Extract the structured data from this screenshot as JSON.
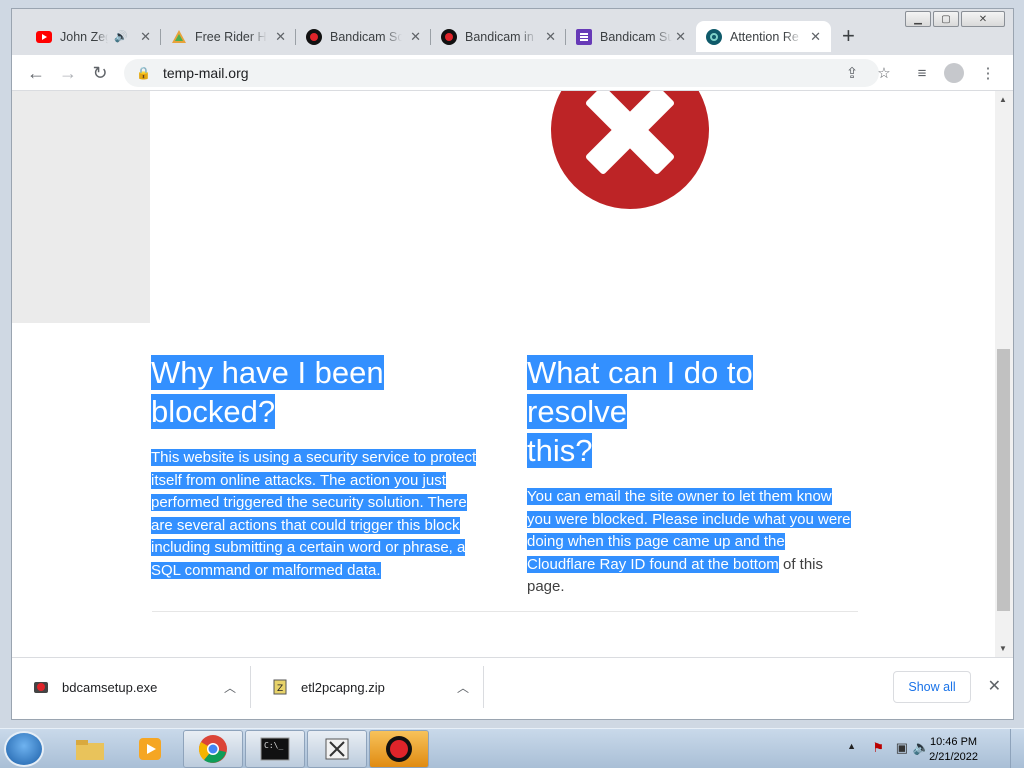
{
  "browser": {
    "tabs": [
      {
        "title": "John Zeg",
        "favicon": "youtube-icon",
        "audio": true
      },
      {
        "title": "Free Rider HD",
        "favicon": "chrome-web-icon"
      },
      {
        "title": "Bandicam Sc",
        "favicon": "bandicam-icon"
      },
      {
        "title": "Bandicam in",
        "favicon": "bandicam-icon"
      },
      {
        "title": "Bandicam Su",
        "favicon": "forms-icon"
      },
      {
        "title": "Attention Re",
        "favicon": "cloudflare-icon",
        "active": true
      }
    ],
    "url": "temp-mail.org"
  },
  "page": {
    "left": {
      "heading_line1": "Why have I been",
      "heading_line2": "blocked?",
      "body": "This website is using a security service to protect itself from online attacks. The action you just performed triggered the security solution. There are several actions that could trigger this block including submitting a certain word or phrase, a SQL command or malformed data."
    },
    "right": {
      "heading_line1": "What can I do to resolve",
      "heading_line2": "this?",
      "body_highlighted": "You can email the site owner to let them know you were blocked. Please include what you were doing when this page came up and the Cloudflare Ray ID found at the bottom",
      "body_plain": " of this page."
    },
    "accent_color": "#bd2426",
    "selection_color": "#3390ff"
  },
  "downloads": {
    "items": [
      {
        "name": "bdcamsetup.exe"
      },
      {
        "name": "etl2pcapng.zip"
      }
    ],
    "show_all": "Show all"
  },
  "taskbar": {
    "time": "10:46 PM",
    "date": "2/21/2022"
  }
}
